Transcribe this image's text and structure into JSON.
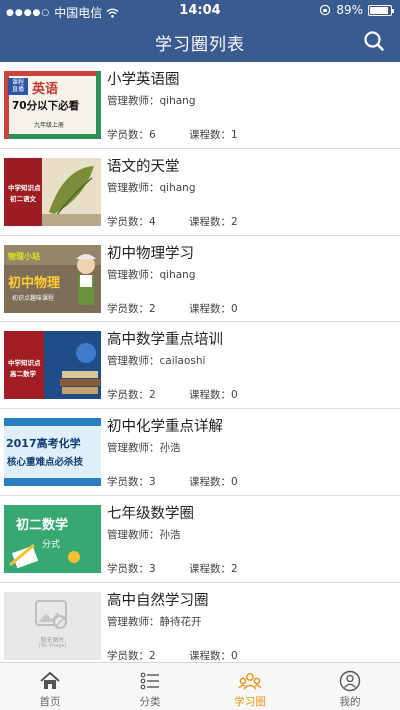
{
  "status_bar": {
    "carrier": "中国电信",
    "time": "14:04",
    "battery": "89%",
    "battery_level": 0.89
  },
  "nav": {
    "title": "学习圈列表",
    "search_icon": "search-icon"
  },
  "circles": [
    {
      "title": "小学英语圈",
      "teacher": "管理教师：qihang",
      "students": "学员数：6",
      "courses": "课程数：1",
      "thumb": {
        "lines": [
          "英语",
          "70分以下必看",
          "九年级上册"
        ],
        "badge": "课程\n直播"
      }
    },
    {
      "title": "语文的天堂",
      "teacher": "管理教师：qihang",
      "students": "学员数：4",
      "courses": "课程数：2",
      "thumb": {
        "lines": [
          "中学知识点",
          "初二语文"
        ]
      }
    },
    {
      "title": "初中物理学习",
      "teacher": "管理教师：qihang",
      "students": "学员数：2",
      "courses": "课程数：0",
      "thumb": {
        "lines": [
          "物理小站",
          "初中物理",
          "初识点趣味课程"
        ]
      }
    },
    {
      "title": "高中数学重点培训",
      "teacher": "管理教师：cailaoshi",
      "students": "学员数：2",
      "courses": "课程数：0",
      "thumb": {
        "lines": [
          "中学知识点",
          "高二数学"
        ]
      }
    },
    {
      "title": "初中化学重点详解",
      "teacher": "管理教师：孙浩",
      "students": "学员数：3",
      "courses": "课程数：0",
      "thumb": {
        "lines": [
          "2017高考化学",
          "核心重难点必杀技"
        ]
      }
    },
    {
      "title": "七年级数学圈",
      "teacher": "管理教师：孙浩",
      "students": "学员数：3",
      "courses": "课程数：2",
      "thumb": {
        "lines": [
          "初二数学",
          "分式"
        ]
      }
    },
    {
      "title": "高中自然学习圈",
      "teacher": "管理教师：静待花开",
      "students": "学员数：2",
      "courses": "课程数：0",
      "thumb": {
        "lines": [
          "暂无图片",
          "(No image)"
        ]
      }
    }
  ],
  "tabs": [
    {
      "label": "首页",
      "icon": "home-icon",
      "active": false
    },
    {
      "label": "分类",
      "icon": "category-list-icon",
      "active": false
    },
    {
      "label": "学习圈",
      "icon": "study-circle-icon",
      "active": true
    },
    {
      "label": "我的",
      "icon": "profile-icon",
      "active": false
    }
  ],
  "colors": {
    "header": "#3a5b8f",
    "active_tab": "#e8951f",
    "divider": "#dedede"
  }
}
